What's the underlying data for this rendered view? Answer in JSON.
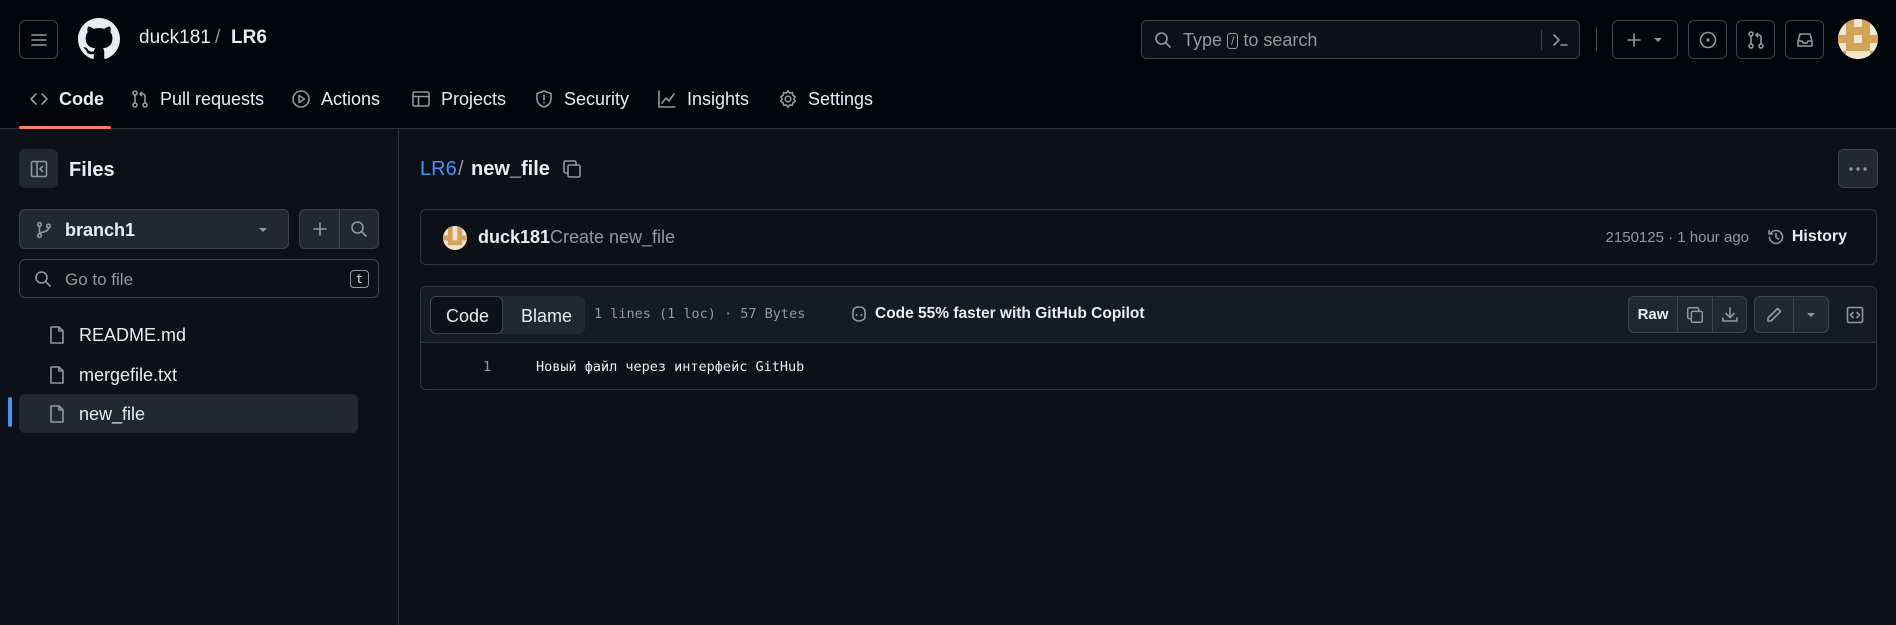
{
  "header": {
    "owner": "duck181",
    "separator": "/",
    "repo": "LR6",
    "search_prefix": "Type",
    "search_key": "/",
    "search_suffix": "to search"
  },
  "tabs": [
    {
      "label": "Code",
      "icon": "code-icon",
      "active": true
    },
    {
      "label": "Pull requests",
      "icon": "git-pull-request-icon"
    },
    {
      "label": "Actions",
      "icon": "play-icon"
    },
    {
      "label": "Projects",
      "icon": "table-icon"
    },
    {
      "label": "Security",
      "icon": "shield-icon"
    },
    {
      "label": "Insights",
      "icon": "graph-icon"
    },
    {
      "label": "Settings",
      "icon": "gear-icon"
    }
  ],
  "sidebar": {
    "title": "Files",
    "branch": "branch1",
    "goto_placeholder": "Go to file",
    "goto_key": "t",
    "files": [
      {
        "name": "README.md"
      },
      {
        "name": "mergefile.txt"
      },
      {
        "name": "new_file",
        "selected": true
      }
    ]
  },
  "main": {
    "path_repo": "LR6",
    "path_sep": "/",
    "path_file": "new_file",
    "commit": {
      "author": "duck181",
      "message": "Create new_file",
      "meta": "2150125 · 1 hour ago",
      "history_label": "History"
    },
    "file": {
      "tab_code": "Code",
      "tab_blame": "Blame",
      "meta": "1 lines (1 loc) · 57 Bytes",
      "copilot": "Code 55% faster with GitHub Copilot",
      "raw_label": "Raw",
      "lines": [
        {
          "num": "1",
          "text": "Новый файл через интерфейс GitHub"
        }
      ]
    }
  },
  "colors": {
    "bg": "#0d1117",
    "header_bg": "#010409",
    "accent_underline": "#f78166",
    "link": "#4493f8",
    "selected_marker": "#4493f8"
  }
}
